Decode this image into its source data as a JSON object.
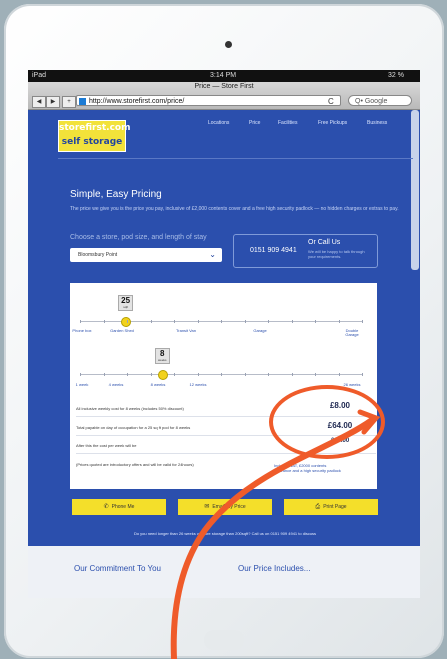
{
  "device": {
    "carrier": "iPad",
    "time": "3:14 PM",
    "battery": "32 %"
  },
  "browser": {
    "title": "Price — Store First",
    "url": "http://www.storefirst.com/price/",
    "search_placeholder": "Q• Google",
    "reload": "C",
    "back": "◀",
    "forward": "▶",
    "add": "+"
  },
  "logo": {
    "line1": "storefirst.com",
    "line2": "self storage"
  },
  "nav": [
    "Locations",
    "Price",
    "Facilities",
    "Free Pickups",
    "Business"
  ],
  "hero": {
    "title": "Simple, Easy Pricing",
    "intro": "The price we give you is the price you pay, inclusive of £2,000 contents cover and a free high security padlock — no hidden charges or extras to pay.",
    "choose": "Choose a store, pod size, and length of stay",
    "store_select": "Bloomsbury Point",
    "phone": "0151 909 4941",
    "or_call": "Or Call Us",
    "help": "We will be happy to talk through your requirements."
  },
  "size_slider": {
    "value": "25",
    "unit": "sqft",
    "fraction": 0.16,
    "labels": [
      "Phone box",
      "Garden Shed",
      "Transit Van",
      "Garage",
      "Double Garage"
    ]
  },
  "weeks_slider": {
    "value": "8",
    "unit": "weeks",
    "fraction": 0.29,
    "labels": [
      "1 week",
      "4 weeks",
      "8 weeks",
      "12 weeks",
      "26 weeks"
    ]
  },
  "rows": [
    {
      "label": "All inclusive weekly cost for 8 weeks (includes 50% discount)",
      "price": "£8.00"
    },
    {
      "label": "Total payable on day of occupation for a 25 sq ft pod for 8 weeks",
      "price": "£64.00"
    },
    {
      "label": "After this the cost per week will be",
      "price": "£16.00"
    },
    {
      "label": "(Prices quoted are introductory offers and will be valid for 24hours)",
      "price": ""
    }
  ],
  "vat_note": "Includes VAT, £2000 contents insurance and a high security padlock",
  "buttons": [
    {
      "label": "Phone Me",
      "icon": "phone-icon",
      "glyph": "✆"
    },
    {
      "label": "Email My Price",
      "icon": "envelope-icon",
      "glyph": "✉"
    },
    {
      "label": "Print Page",
      "icon": "printer-icon",
      "glyph": "⎙"
    }
  ],
  "footer_question": "Do you need longer than 26 weeks or more storage than 200sqft? Call us on 0151 909 4941 to discuss",
  "bottom": {
    "left": "Our Commitment To You",
    "right": "Our Price Includes..."
  },
  "colors": {
    "brand_blue": "#2b4fad",
    "accent_yellow": "#f4df2a",
    "annotation_orange": "#ef5b2a"
  }
}
